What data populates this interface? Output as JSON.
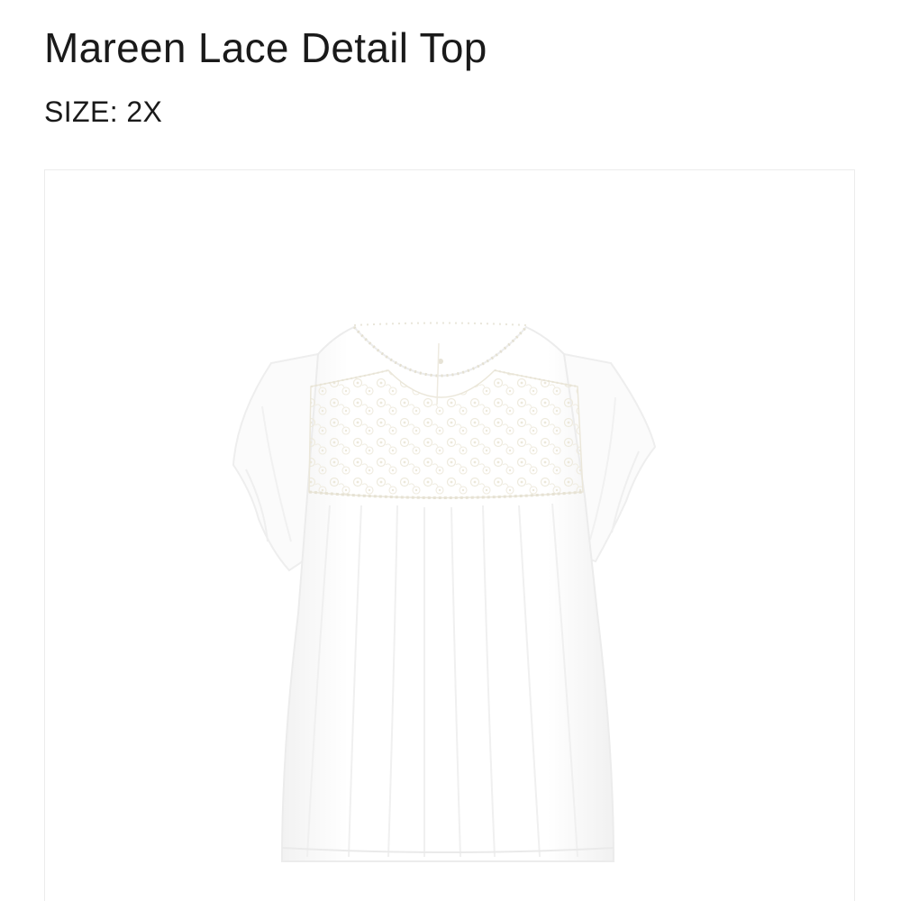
{
  "product": {
    "name": "Mareen Lace Detail Top",
    "size_label": "SIZE:",
    "size_value": "2X"
  },
  "image": {
    "subject": "white-flutter-sleeve-lace-yoke-top",
    "background_color": "#ffffff",
    "garment_color": "#ffffff"
  }
}
